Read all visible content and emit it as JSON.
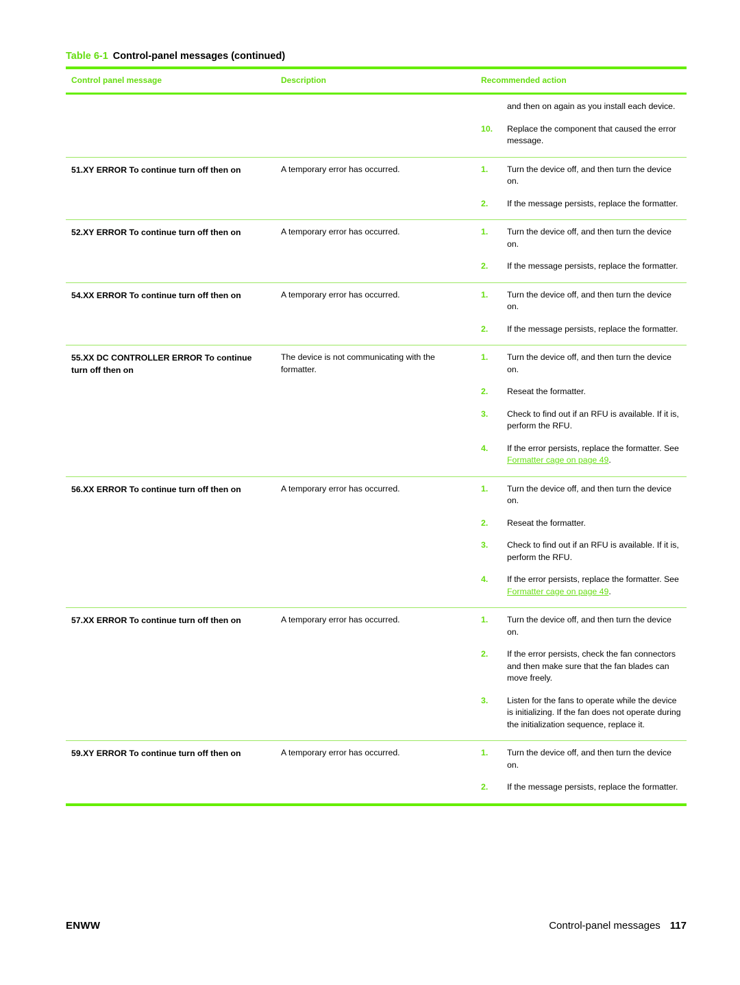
{
  "table": {
    "caption_label": "Table 6-1",
    "caption_title": "Control-panel messages (continued)",
    "columns": [
      "Control panel message",
      "Description",
      "Recommended action"
    ],
    "accent_color": "#66dd11",
    "rule_color": "#66ee00",
    "row_rule_color": "#9ce861",
    "rows": [
      {
        "message": "",
        "description": "",
        "continuation_text": "and then on again as you install each device.",
        "actions": [
          {
            "num": "10.",
            "text": "Replace the component that caused the error message."
          }
        ]
      },
      {
        "message": "51.XY ERROR To continue turn off then on",
        "description": "A temporary error has occurred.",
        "actions": [
          {
            "num": "1.",
            "text": "Turn the device off, and then turn the device on."
          },
          {
            "num": "2.",
            "text": "If the message persists, replace the formatter."
          }
        ]
      },
      {
        "message": "52.XY ERROR To continue turn off then on",
        "description": "A temporary error has occurred.",
        "actions": [
          {
            "num": "1.",
            "text": "Turn the device off, and then turn the device on."
          },
          {
            "num": "2.",
            "text": "If the message persists, replace the formatter."
          }
        ]
      },
      {
        "message": "54.XX ERROR To continue turn off then on",
        "description": "A temporary error has occurred.",
        "actions": [
          {
            "num": "1.",
            "text": "Turn the device off, and then turn the device on."
          },
          {
            "num": "2.",
            "text": "If the message persists, replace the formatter."
          }
        ]
      },
      {
        "message": "55.XX DC CONTROLLER ERROR To continue turn off then on",
        "description": "The device is not communicating with the formatter.",
        "actions": [
          {
            "num": "1.",
            "text": "Turn the device off, and then turn the device on."
          },
          {
            "num": "2.",
            "text": "Reseat the formatter."
          },
          {
            "num": "3.",
            "text": "Check to find out if an RFU is available. If it is, perform the RFU."
          },
          {
            "num": "4.",
            "text_before": "If the error persists, replace the formatter. See ",
            "link_text": "Formatter cage on page 49",
            "text_after": "."
          }
        ]
      },
      {
        "message": "56.XX ERROR To continue turn off then on",
        "description": "A temporary error has occurred.",
        "actions": [
          {
            "num": "1.",
            "text": "Turn the device off, and then turn the device on."
          },
          {
            "num": "2.",
            "text": "Reseat the formatter."
          },
          {
            "num": "3.",
            "text": "Check to find out if an RFU is available. If it is, perform the RFU."
          },
          {
            "num": "4.",
            "text_before": "If the error persists, replace the formatter. See ",
            "link_text": "Formatter cage on page 49",
            "text_after": "."
          }
        ]
      },
      {
        "message": "57.XX ERROR To continue turn off then on",
        "description": "A temporary error has occurred.",
        "actions": [
          {
            "num": "1.",
            "text": "Turn the device off, and then turn the device on."
          },
          {
            "num": "2.",
            "text": "If the error persists, check the fan connectors and then make sure that the fan blades can move freely."
          },
          {
            "num": "3.",
            "text": "Listen for the fans to operate while the device is initializing. If the fan does not operate during the initialization sequence, replace it."
          }
        ]
      },
      {
        "message": "59.XY ERROR To continue turn off then on",
        "description": "A temporary error has occurred.",
        "actions": [
          {
            "num": "1.",
            "text": "Turn the device off, and then turn the device on."
          },
          {
            "num": "2.",
            "text": "If the message persists, replace the formatter."
          }
        ]
      }
    ]
  },
  "footer": {
    "left": "ENWW",
    "section": "Control-panel messages",
    "page_number": "117"
  }
}
